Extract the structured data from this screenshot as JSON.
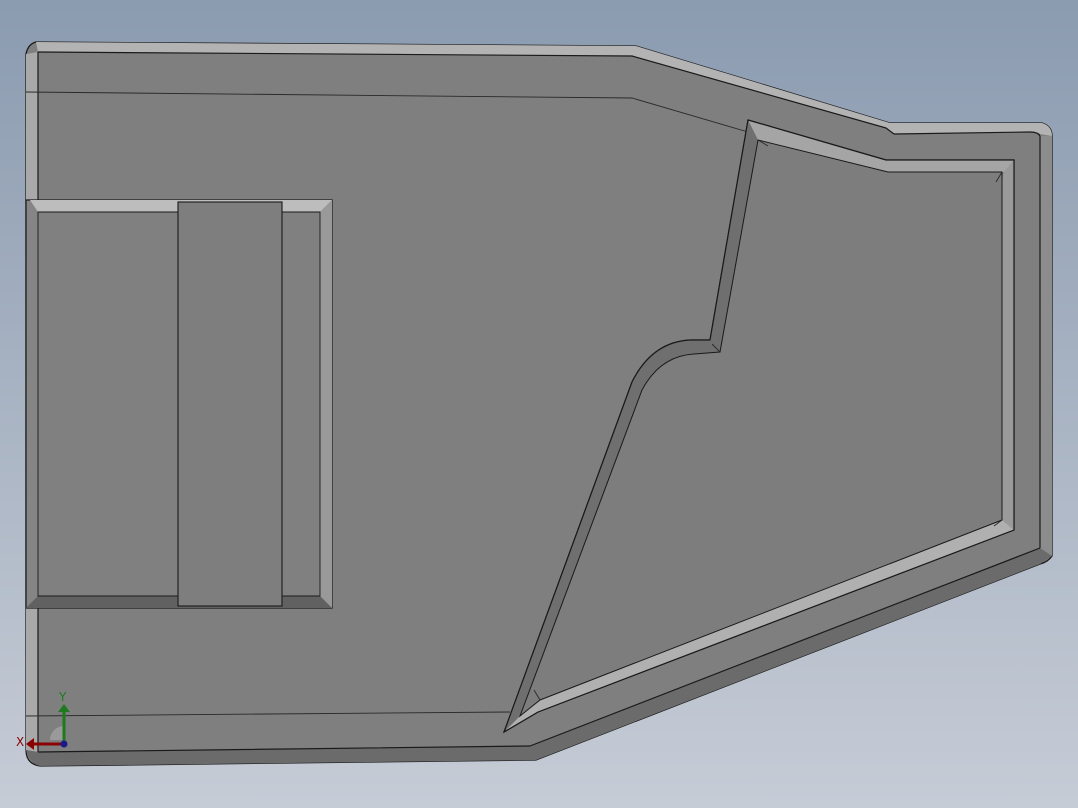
{
  "view": {
    "background_top": "#8b9bb0",
    "background_bottom": "#c6ccd6",
    "part_color": "#7f7f7f",
    "fillet_light": "#b5b5b5",
    "fillet_dark": "#5e5e5e",
    "edge_color": "#1a1a1a"
  },
  "triad": {
    "x_label": "X",
    "y_label": "Y",
    "x_color": "#8b0000",
    "y_color": "#1f7a1f",
    "z_color": "#1a1a8b"
  }
}
